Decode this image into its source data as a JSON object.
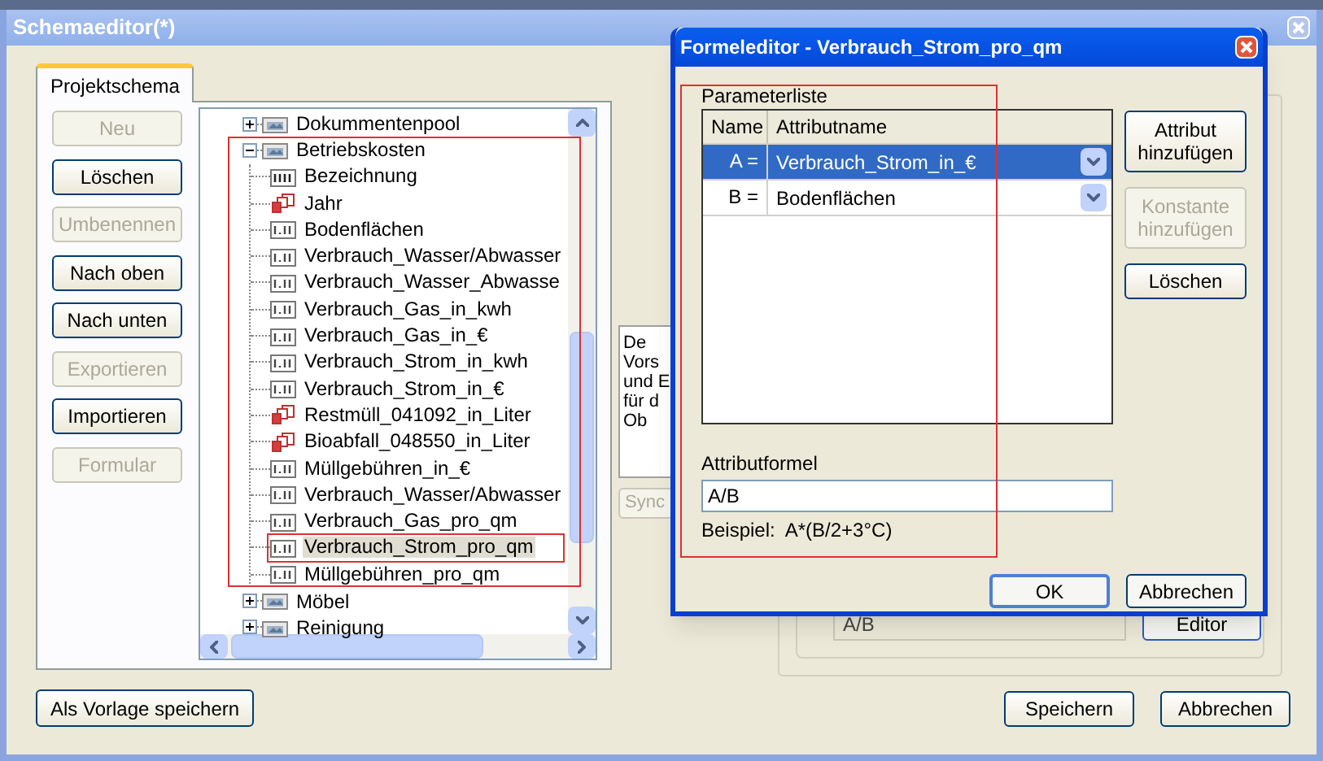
{
  "window": {
    "title": "Schemaeditor(*)"
  },
  "tabs": [
    {
      "label": "Projektschema",
      "selected": true
    }
  ],
  "side_buttons": [
    {
      "label": "Neu",
      "disabled": true
    },
    {
      "label": "Löschen",
      "disabled": false
    },
    {
      "label": "Umbenennen",
      "disabled": true
    },
    {
      "label": "Nach oben",
      "disabled": false
    },
    {
      "label": "Nach unten",
      "disabled": false
    },
    {
      "label": "Exportieren",
      "disabled": true
    },
    {
      "label": "Importieren",
      "disabled": false
    },
    {
      "label": "Formular",
      "disabled": true
    }
  ],
  "tree": {
    "items": [
      {
        "label": "Dokummentenpool",
        "kind": "folder",
        "expanded": false,
        "selected": false
      },
      {
        "label": "Betriebskosten",
        "kind": "folder",
        "expanded": true,
        "selected": false,
        "children": [
          {
            "label": "Bezeichnung",
            "kind": "text",
            "selected": false
          },
          {
            "label": "Jahr",
            "kind": "integer",
            "selected": false
          },
          {
            "label": "Bodenflächen",
            "kind": "decimal",
            "selected": false
          },
          {
            "label": "Verbrauch_Wasser/Abwasser",
            "kind": "decimal",
            "selected": false
          },
          {
            "label": "Verbrauch_Wasser_Abwasse",
            "kind": "decimal",
            "selected": false
          },
          {
            "label": "Verbrauch_Gas_in_kwh",
            "kind": "decimal",
            "selected": false
          },
          {
            "label": "Verbrauch_Gas_in_€",
            "kind": "decimal",
            "selected": false
          },
          {
            "label": "Verbrauch_Strom_in_kwh",
            "kind": "decimal",
            "selected": false
          },
          {
            "label": "Verbrauch_Strom_in_€",
            "kind": "decimal",
            "selected": false
          },
          {
            "label": "Restmüll_041092_in_Liter",
            "kind": "integer",
            "selected": false
          },
          {
            "label": "Bioabfall_048550_in_Liter",
            "kind": "integer",
            "selected": false
          },
          {
            "label": "Müllgebühren_in_€",
            "kind": "decimal",
            "selected": false
          },
          {
            "label": "Verbrauch_Wasser/Abwasser",
            "kind": "decimal",
            "selected": false
          },
          {
            "label": "Verbrauch_Gas_pro_qm",
            "kind": "decimal",
            "selected": false
          },
          {
            "label": "Verbrauch_Strom_pro_qm",
            "kind": "decimal",
            "selected": true
          },
          {
            "label": "Müllgebühren_pro_qm",
            "kind": "decimal",
            "selected": false
          }
        ]
      },
      {
        "label": "Möbel",
        "kind": "folder",
        "expanded": false,
        "selected": false
      },
      {
        "label": "Reinigung",
        "kind": "folder",
        "expanded": false,
        "selected": false
      }
    ]
  },
  "info_box_fragments": [
    "De",
    "Vors",
    "und E",
    "für d",
    "Ob"
  ],
  "sync_button": {
    "label": "Sync",
    "disabled": true
  },
  "formula_field": {
    "value": "A/B",
    "button": "Editor"
  },
  "template_button": "Als Vorlage speichern",
  "footer_buttons": [
    "Speichern",
    "Abbrechen"
  ],
  "dialog": {
    "title": "Formeleditor - Verbrauch_Strom_pro_qm",
    "parameter_label": "Parameterliste",
    "columns": [
      "Name",
      "Attributname"
    ],
    "rows": [
      {
        "name": "A =",
        "attribute": "Verbrauch_Strom_in_€",
        "selected": true
      },
      {
        "name": "B =",
        "attribute": "Bodenflächen",
        "selected": false
      }
    ],
    "buttons": [
      {
        "label": "Attribut hinzufügen",
        "disabled": false
      },
      {
        "label": "Konstante hinzufügen",
        "disabled": true
      },
      {
        "label": "Löschen",
        "disabled": false
      }
    ],
    "formula_label": "Attributformel",
    "formula": "A/B",
    "example": "Beispiel:  A*(B/2+3°C)",
    "ok": "OK",
    "cancel": "Abbrechen"
  }
}
